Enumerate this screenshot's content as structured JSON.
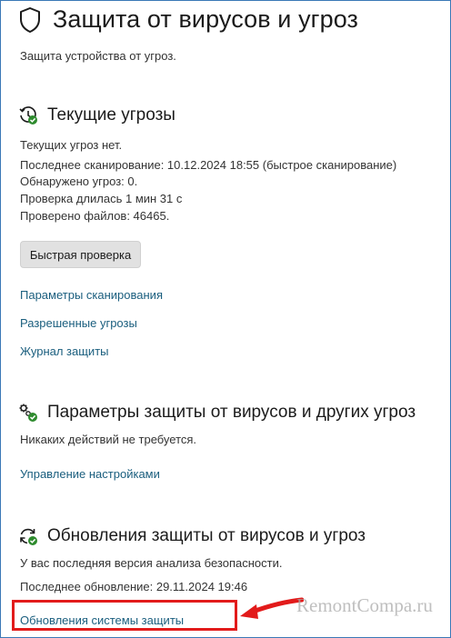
{
  "header": {
    "icon": "shield-icon",
    "title": "Защита от вирусов и угроз",
    "subtitle": "Защита устройства от угроз."
  },
  "current_threats": {
    "icon": "clock-check-icon",
    "title": "Текущие угрозы",
    "lines": [
      "Текущих угроз нет.",
      "Последнее сканирование: 10.12.2024 18:55 (быстрое сканирование)",
      "Обнаружено угроз: 0.",
      "Проверка длилась 1 мин 31 с",
      "Проверено файлов: 46465."
    ],
    "quick_scan_label": "Быстрая проверка",
    "links": [
      "Параметры сканирования",
      "Разрешенные угрозы",
      "Журнал защиты"
    ]
  },
  "protection_settings": {
    "icon": "gears-check-icon",
    "title": "Параметры защиты от вирусов и других угроз",
    "status": "Никаких действий не требуется.",
    "manage_link": "Управление настройками"
  },
  "updates": {
    "icon": "refresh-check-icon",
    "title": "Обновления защиты от вирусов и угроз",
    "status": "У вас последняя версия анализа безопасности.",
    "last_update": "Последнее обновление: 29.11.2024 19:46",
    "updates_link": "Обновления системы защиты"
  },
  "annotation": {
    "highlight_color": "#e21b1b",
    "watermark": "RemontCompa.ru"
  },
  "colors": {
    "link": "#1a5e7e",
    "accent_green": "#2e8b2e",
    "frame_border": "#3a78b6"
  }
}
